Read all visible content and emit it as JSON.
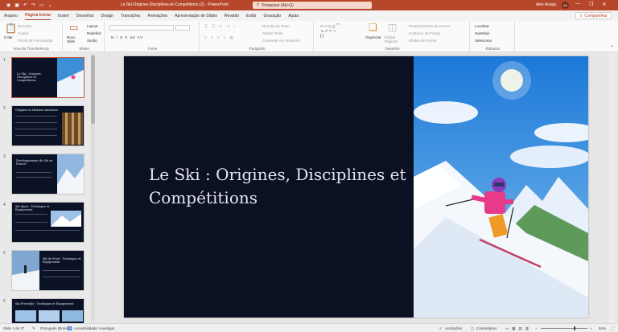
{
  "titlebar": {
    "document_title": "Le Ski-Origines-Disciplines-et-Compétitions (2) - PowerPoint",
    "search_placeholder": "Pesquisar (Alt+Q)",
    "user_name": "Alex Araujo",
    "user_initials": "AA"
  },
  "tabs": [
    "Arquivo",
    "Página Inicial",
    "Inserir",
    "Desenhar",
    "Design",
    "Transições",
    "Animações",
    "Apresentação de Slides",
    "Revisão",
    "Exibir",
    "Gravação",
    "Ajuda"
  ],
  "active_tab": "Página Inicial",
  "share_label": "Compartilhar",
  "ribbon": {
    "clipboard": {
      "paste": "Colar",
      "cut": "Recortar",
      "copy": "Copiar",
      "format_painter": "Pincel de Formatação",
      "label": "Área de Transferência"
    },
    "slides": {
      "new_slide": "Novo Slide",
      "layout": "Layout",
      "reset": "Redefinir",
      "section": "Seção",
      "label": "Slides"
    },
    "font": {
      "label": "Fonte",
      "buttons": "N  I  S  S  ab  AV"
    },
    "paragraph": {
      "text_direction": "Direção do Texto",
      "align_text": "Alinhar Texto",
      "convert_smartart": "Converter em SmartArt",
      "label": "Parágrafo"
    },
    "drawing": {
      "arrange": "Organizar",
      "quick_styles": "Estilos Rápidos",
      "shape_fill": "Preenchimento da Forma",
      "shape_outline": "Contorno da Forma",
      "shape_effects": "Efeitos de Forma",
      "label": "Desenho"
    },
    "editing": {
      "find": "Localizar",
      "replace": "Substituir",
      "select": "Selecionar",
      "label": "Editando"
    }
  },
  "thumbnails": [
    {
      "num": "1",
      "title": "Le Ski : Origines, Disciplines et Compétitions"
    },
    {
      "num": "2",
      "title": "Origines et Histoire Ancienne"
    },
    {
      "num": "3",
      "title": "Développement du Ski en France"
    },
    {
      "num": "4",
      "title": "Ski Alpin : Technique et Équipement"
    },
    {
      "num": "5",
      "title": "Ski de Fond : Technique et Équipement"
    },
    {
      "num": "6",
      "title": "Ski Freestyle : Technique et Équipement"
    }
  ],
  "slide": {
    "title": "Le Ski : Origines, Disciplines et Compétitions"
  },
  "status": {
    "slide_count": "Slide 1 de 27",
    "language": "Português (Brasil)",
    "accessibility": "Acessibilidade: investigar",
    "notes": "Anotações",
    "comments": "Comentários",
    "zoom": "94%"
  },
  "colors": {
    "accent": "#b7472a",
    "slide_bg": "#0b1022"
  }
}
